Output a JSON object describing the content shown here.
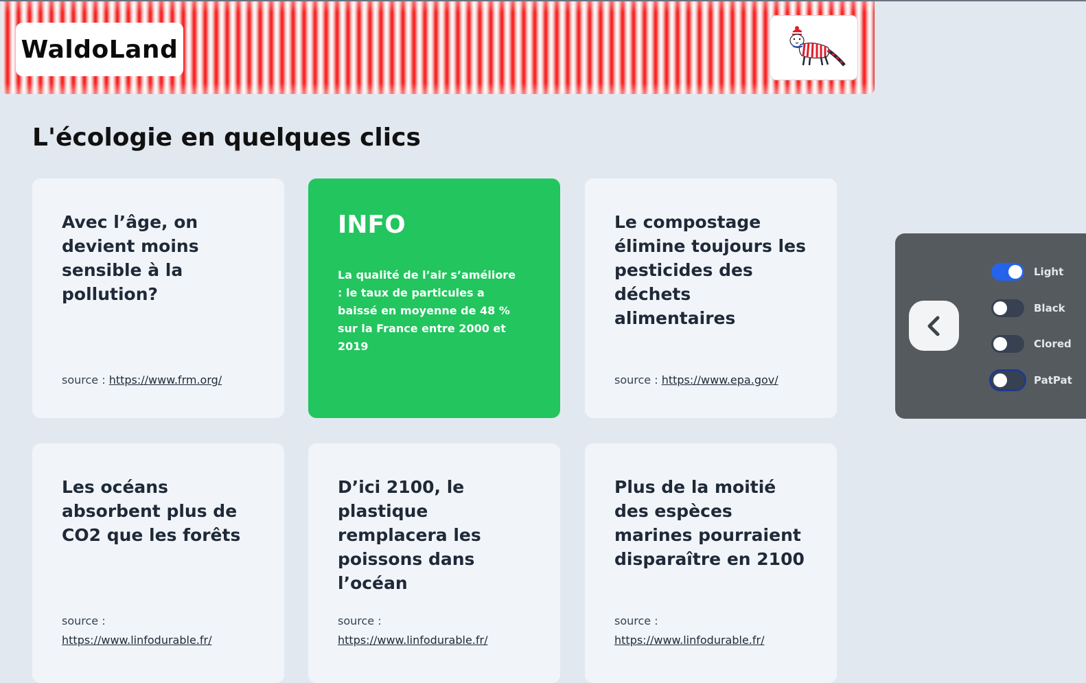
{
  "header": {
    "logo": "WaldoLand",
    "avatar_icon": "waldo-cat-icon"
  },
  "page_title": "L'écologie en quelques clics",
  "cards": [
    {
      "title": "Avec l’âge, on devient moins sensible à la pollution?",
      "source_prefix": "source : ",
      "source_link": "https://www.frm.org/"
    },
    {
      "title": "INFO",
      "body": "La qualité de l’air s’améliore : le taux de particules a baissé en moyenne de 48 % sur la France entre 2000 et 2019",
      "color": "#22c55e"
    },
    {
      "title": "Le compostage élimine toujours les pesticides des déchets alimentaires",
      "source_prefix": "source : ",
      "source_link": "https://www.epa.gov/"
    },
    {
      "title": "Les océans absorbent plus de CO2 que les forêts",
      "source_prefix": "source : ",
      "source_link": "https://www.linfodurable.fr/"
    },
    {
      "title": "D’ici 2100, le plastique remplacera les poissons dans l’océan",
      "source_prefix": "source : ",
      "source_link": "https://www.linfodurable.fr/"
    },
    {
      "title": "Plus de la moitié des espèces marines pourraient disparaître en 2100",
      "source_prefix": "source : ",
      "source_link": "https://www.linfodurable.fr/"
    }
  ],
  "theme_panel": {
    "back_icon": "chevron-left-icon",
    "toggles": [
      {
        "label": "Light",
        "on": true
      },
      {
        "label": "Black",
        "on": false
      },
      {
        "label": "Clored",
        "on": false
      },
      {
        "label": "PatPat",
        "on": false
      }
    ]
  },
  "colors": {
    "background": "#e2e8f0",
    "card": "#f1f5f9",
    "accent_green": "#22c55e",
    "toggle_on": "#2563eb",
    "header_red": "#ef2a2a",
    "panel": "#555a5e"
  }
}
